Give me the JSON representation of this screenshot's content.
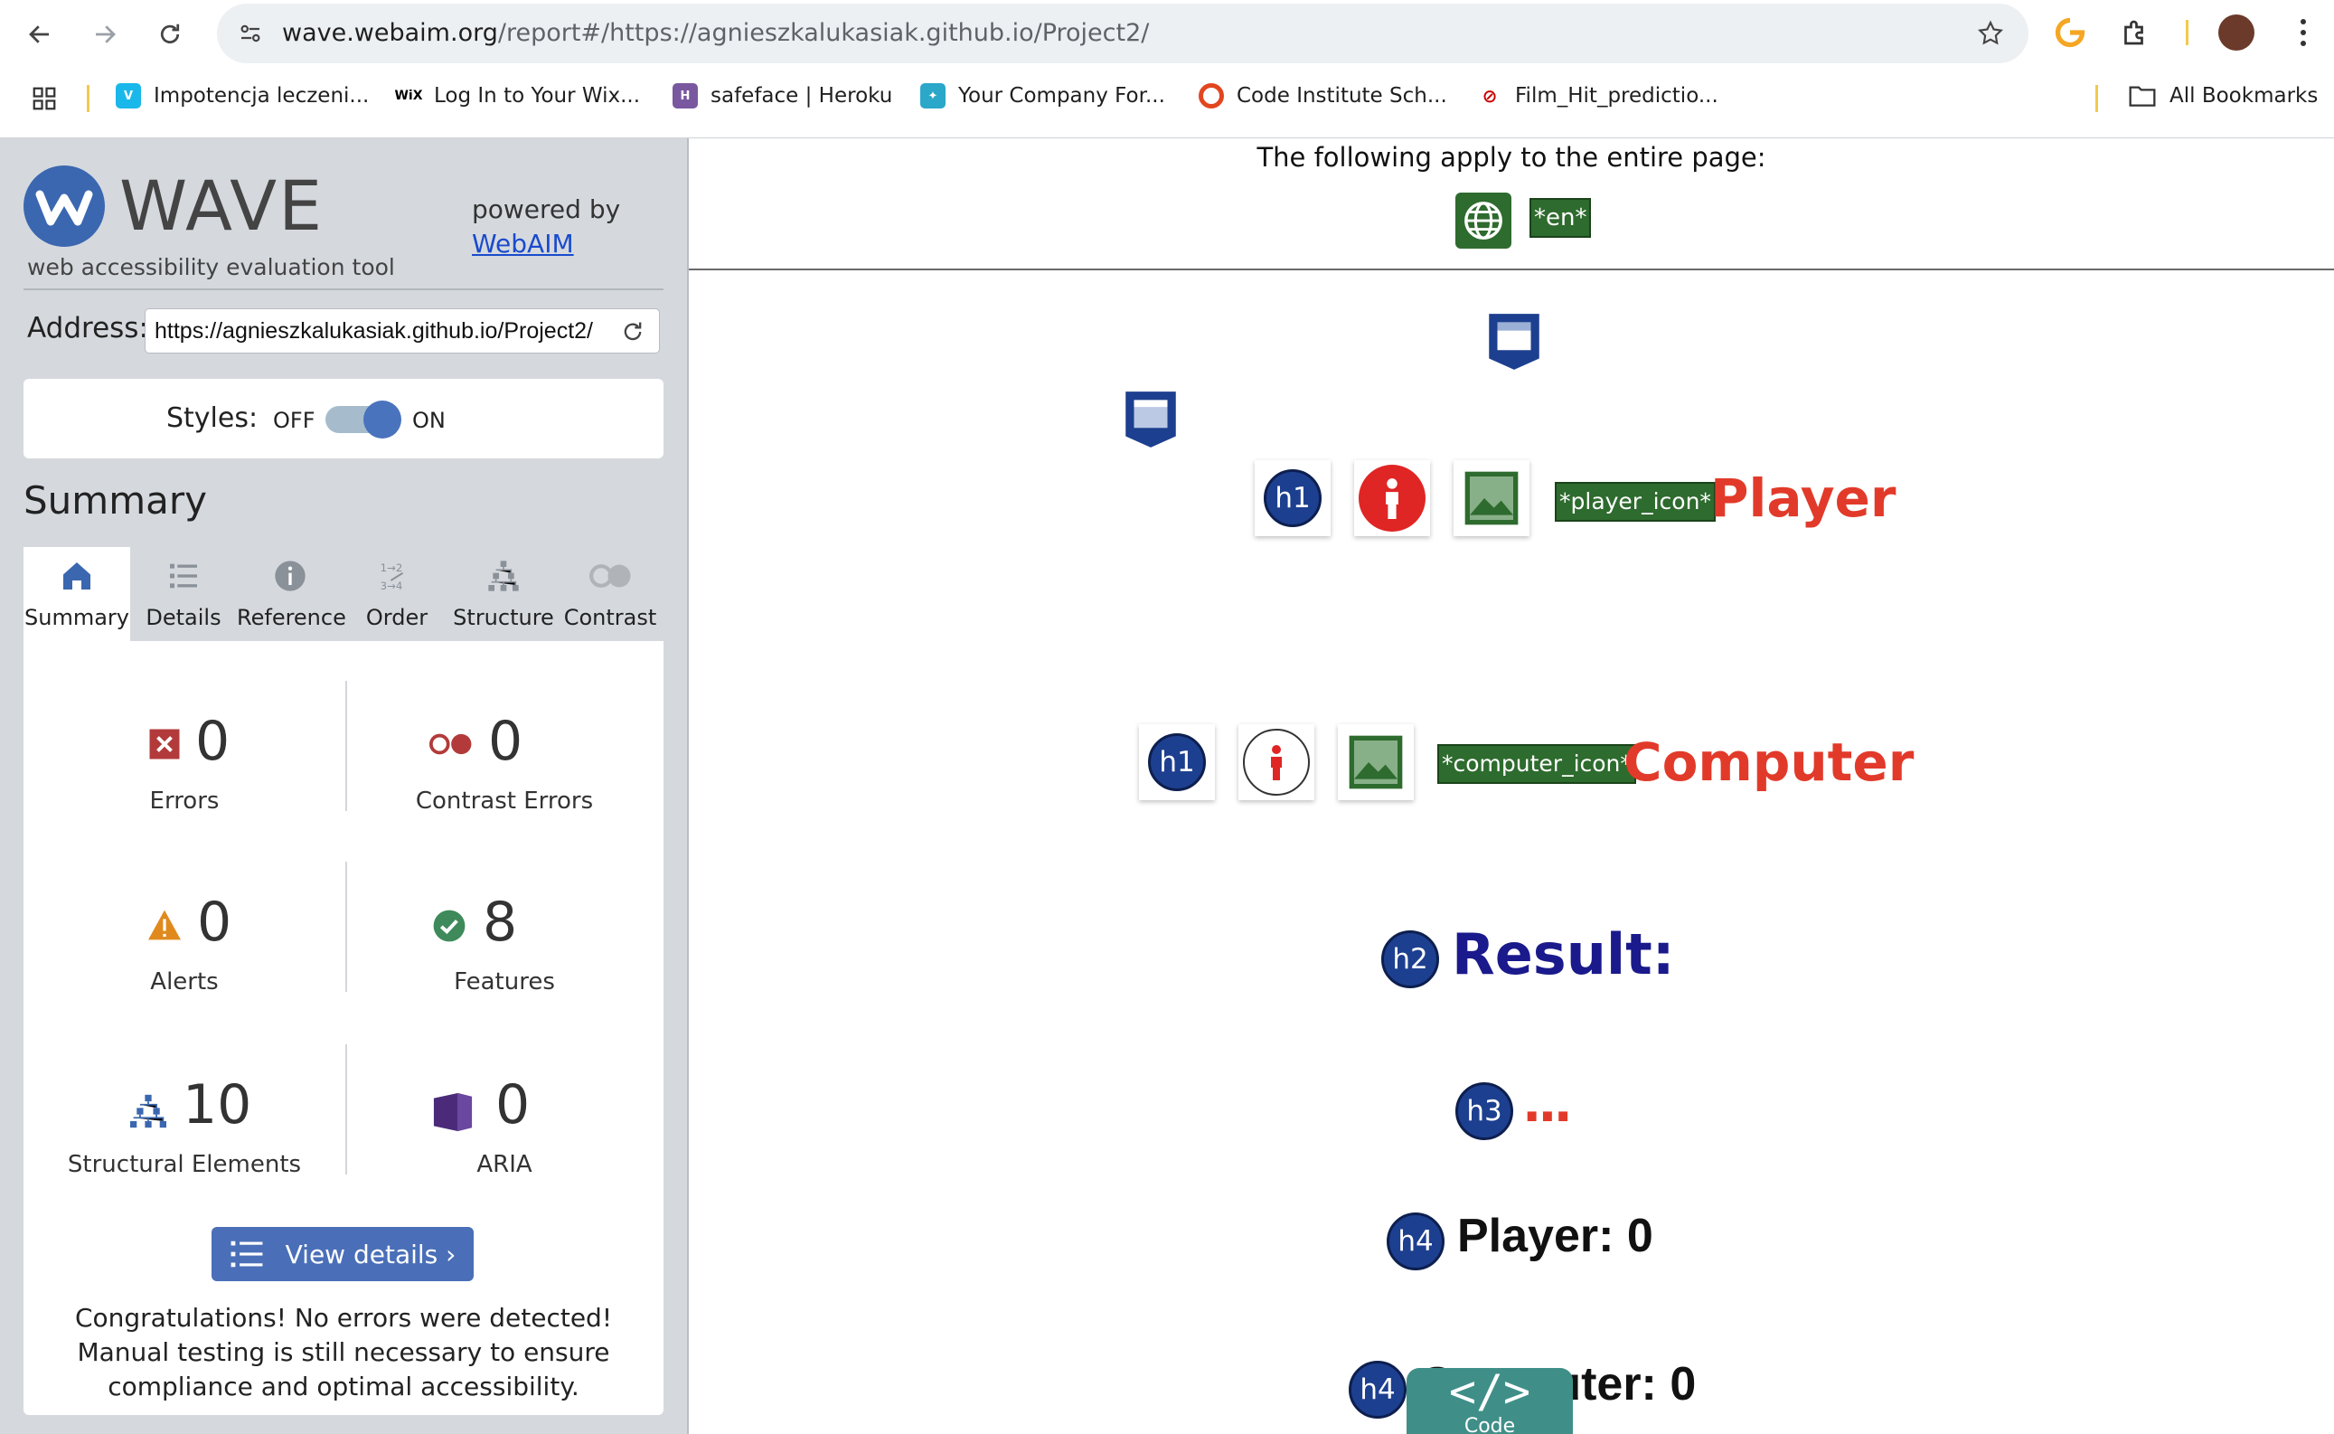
{
  "browser": {
    "url_host": "wave.webaim.org",
    "url_path": "/report#/https://agnieszkalukasiak.github.io/Project2/",
    "bookmarks": [
      {
        "label": "Impotencja leczeni...",
        "icon": "vimeo-icon",
        "color": "#1ab7ea"
      },
      {
        "label": "Log In to Your Wix...",
        "icon": "wix-icon",
        "color": "#000000"
      },
      {
        "label": "safeface | Heroku",
        "icon": "heroku-icon",
        "color": "#79589f"
      },
      {
        "label": "Your Company For...",
        "icon": "bird-icon",
        "color": "#2aa7c9"
      },
      {
        "label": "Code Institute Sch...",
        "icon": "ring-icon",
        "color": "#e2461f"
      },
      {
        "label": "Film_Hit_predictio...",
        "icon": "blocked-icon",
        "color": "#333333"
      }
    ],
    "all_bookmarks": "All Bookmarks"
  },
  "wave": {
    "title": "WAVE",
    "subtitle": "web accessibility evaluation tool",
    "powered_by": "powered by",
    "webaim_link": "WebAIM",
    "address_label": "Address:",
    "address_value": "https://agnieszkalukasiak.github.io/Project2/",
    "styles_label": "Styles:",
    "styles_off": "OFF",
    "styles_on": "ON",
    "styles_state": "on",
    "summary_heading": "Summary",
    "tabs": [
      {
        "label": "Summary",
        "icon": "home-icon",
        "active": true
      },
      {
        "label": "Details",
        "icon": "list-icon"
      },
      {
        "label": "Reference",
        "icon": "info-icon"
      },
      {
        "label": "Order",
        "icon": "order-icon"
      },
      {
        "label": "Structure",
        "icon": "structure-icon"
      },
      {
        "label": "Contrast",
        "icon": "contrast-icon"
      }
    ],
    "metrics": {
      "errors": {
        "value": "0",
        "label": "Errors",
        "color": "#b33a3a"
      },
      "contrast_errors": {
        "value": "0",
        "label": "Contrast Errors",
        "color": "#b33a3a"
      },
      "alerts": {
        "value": "0",
        "label": "Alerts",
        "color": "#e08a1e"
      },
      "features": {
        "value": "8",
        "label": "Features",
        "color": "#3e8a5a"
      },
      "structural": {
        "value": "10",
        "label": "Structural Elements",
        "color": "#3b67b0"
      },
      "aria": {
        "value": "0",
        "label": "ARIA",
        "color": "#4b2a7a"
      }
    },
    "view_details": "View details ›",
    "congrats": "Congratulations! No errors were detected! Manual testing is still necessary to ensure compliance and optimal accessibility."
  },
  "page": {
    "applies_text": "The following apply to the entire page:",
    "lang_label": "*en*",
    "player_alt": "*player_icon*",
    "player_heading": "Player",
    "computer_alt": "*computer_icon*",
    "computer_heading": "Computer",
    "result_heading": "Result:",
    "dots_heading": "...",
    "player_score": "Player: 0",
    "computer_score": "Computer: 0",
    "code_label": "Code",
    "h1": "h1",
    "h2": "h2",
    "h3": "h3",
    "h4": "h4",
    "colors": {
      "red_heading": "#e23a2a",
      "result_blue": "#1a1a8c"
    }
  }
}
